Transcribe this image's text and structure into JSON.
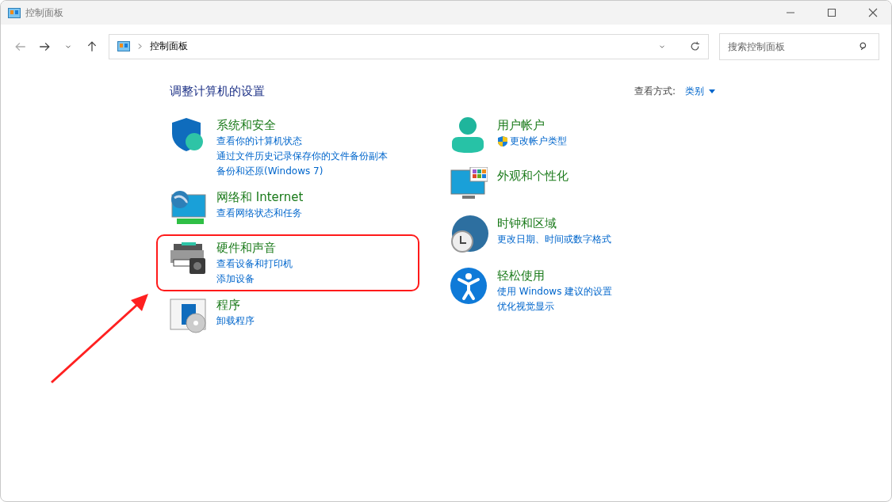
{
  "window": {
    "title": "控制面板"
  },
  "address_bar": {
    "path": "控制面板"
  },
  "search": {
    "placeholder": "搜索控制面板"
  },
  "heading": "调整计算机的设置",
  "view_by": {
    "label": "查看方式:",
    "value": "类别"
  },
  "left_column": [
    {
      "kind": "security",
      "title": "系统和安全",
      "highlighted": false,
      "links": [
        {
          "text": "查看你的计算机状态",
          "shield": false
        },
        {
          "text": "通过文件历史记录保存你的文件备份副本",
          "shield": false
        },
        {
          "text": "备份和还原(Windows 7)",
          "shield": false
        }
      ]
    },
    {
      "kind": "network",
      "title": "网络和 Internet",
      "highlighted": false,
      "links": [
        {
          "text": "查看网络状态和任务",
          "shield": false
        }
      ]
    },
    {
      "kind": "hardware",
      "title": "硬件和声音",
      "highlighted": true,
      "links": [
        {
          "text": "查看设备和打印机",
          "shield": false
        },
        {
          "text": "添加设备",
          "shield": false
        }
      ]
    },
    {
      "kind": "programs",
      "title": "程序",
      "highlighted": false,
      "links": [
        {
          "text": "卸载程序",
          "shield": false
        }
      ]
    }
  ],
  "right_column": [
    {
      "kind": "user",
      "title": "用户帐户",
      "highlighted": false,
      "links": [
        {
          "text": "更改帐户类型",
          "shield": true
        }
      ]
    },
    {
      "kind": "appearance",
      "title": "外观和个性化",
      "highlighted": false
    },
    {
      "kind": "clock",
      "title": "时钟和区域",
      "highlighted": false,
      "links": [
        {
          "text": "更改日期、时间或数字格式",
          "shield": false
        }
      ]
    },
    {
      "kind": "access",
      "title": "轻松使用",
      "highlighted": false,
      "links": [
        {
          "text": "使用 Windows 建议的设置",
          "shield": false
        },
        {
          "text": "优化视觉显示",
          "shield": false
        }
      ]
    }
  ]
}
